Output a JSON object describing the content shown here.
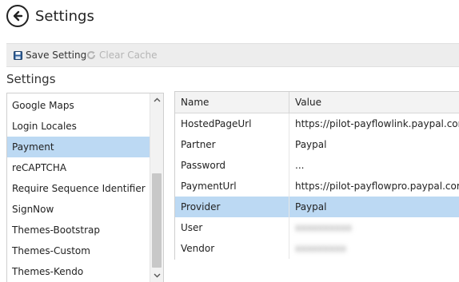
{
  "header": {
    "title": "Settings"
  },
  "toolbar": {
    "save_label": "Save Setting",
    "clear_label": "Clear Cache"
  },
  "section": {
    "title": "Settings"
  },
  "list": {
    "items": [
      {
        "label": "Google Maps"
      },
      {
        "label": "Login Locales"
      },
      {
        "label": "Payment",
        "selected": true
      },
      {
        "label": "reCAPTCHA"
      },
      {
        "label": "Require Sequence Identifier"
      },
      {
        "label": "SignNow"
      },
      {
        "label": "Themes-Bootstrap"
      },
      {
        "label": "Themes-Custom"
      },
      {
        "label": "Themes-Kendo"
      }
    ]
  },
  "grid": {
    "columns": {
      "name": "Name",
      "value": "Value"
    },
    "rows": [
      {
        "name": "HostedPageUrl",
        "value": "https://pilot-payflowlink.paypal.com"
      },
      {
        "name": "Partner",
        "value": "Paypal"
      },
      {
        "name": "Password",
        "value": "..."
      },
      {
        "name": "PaymentUrl",
        "value": "https://pilot-payflowpro.paypal.com"
      },
      {
        "name": "Provider",
        "value": "Paypal",
        "selected": true
      },
      {
        "name": "User",
        "value": "",
        "blurred": true
      },
      {
        "name": "Vendor",
        "value": "",
        "blurred": true
      }
    ]
  },
  "colors": {
    "selection": "#bcd9f3",
    "toolbar": "#ededed",
    "disabled": "#b5b5b5"
  }
}
